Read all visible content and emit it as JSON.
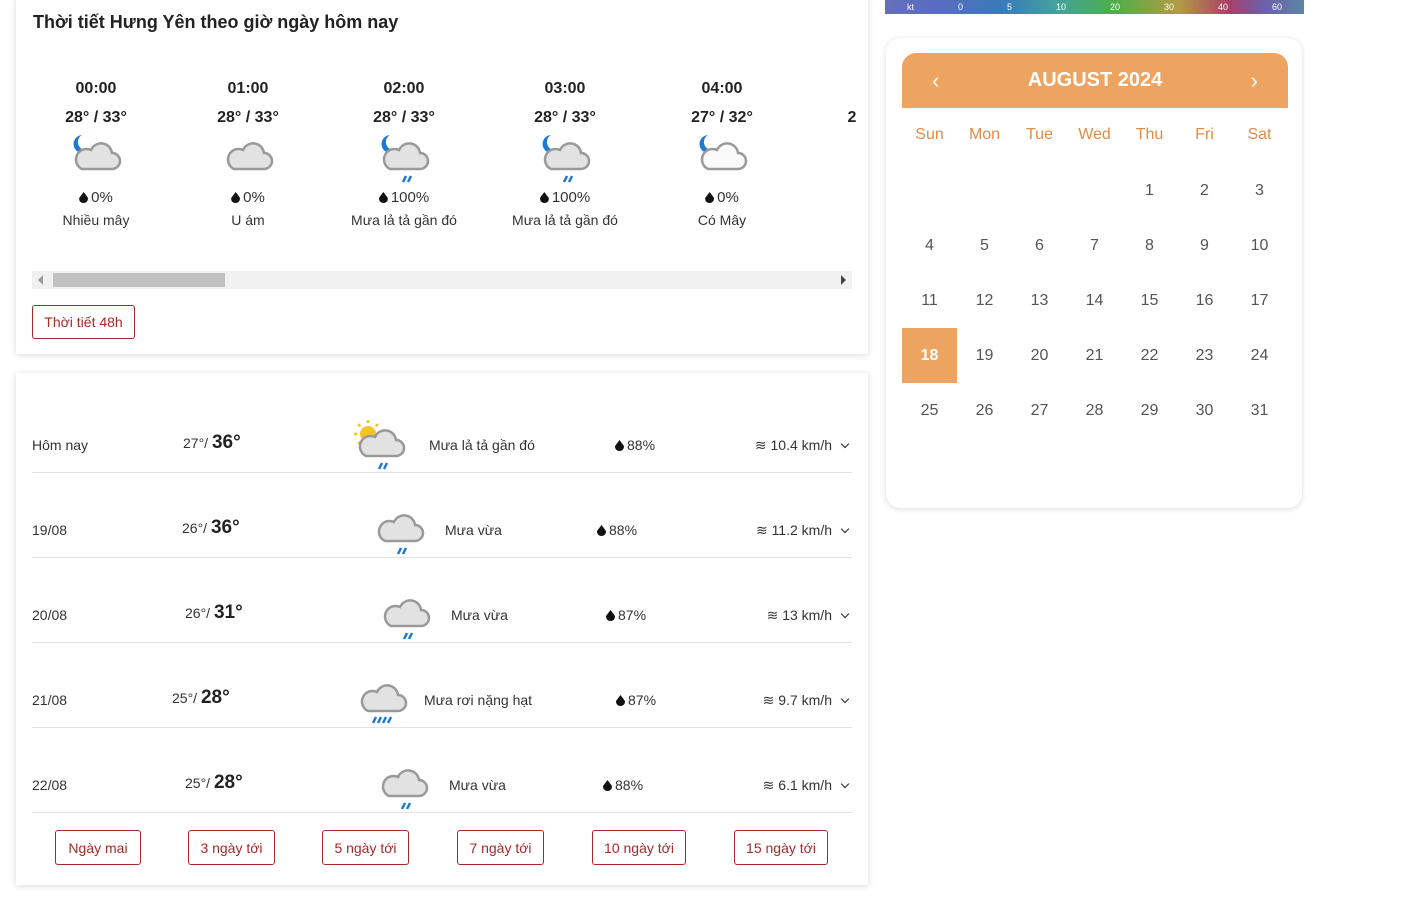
{
  "hourly": {
    "title": "Thời tiết Hưng Yên theo giờ ngày hôm nay",
    "items": [
      {
        "time": "00:00",
        "temp": "28° / 33°",
        "icon": "moon-cloud",
        "precip": "0%",
        "desc": "Nhiều mây"
      },
      {
        "time": "01:00",
        "temp": "28° / 33°",
        "icon": "cloud",
        "precip": "0%",
        "desc": "U ám"
      },
      {
        "time": "02:00",
        "temp": "28° / 33°",
        "icon": "moon-cloud-rain",
        "precip": "100%",
        "desc": "Mưa lả tả gần đó"
      },
      {
        "time": "03:00",
        "temp": "28° / 33°",
        "icon": "moon-cloud-rain",
        "precip": "100%",
        "desc": "Mưa lả tả gần đó"
      },
      {
        "time": "04:00",
        "temp": "27° / 32°",
        "icon": "moon-cloud-light",
        "precip": "0%",
        "desc": "Có Mây"
      },
      {
        "time": "",
        "temp": "2",
        "icon": "moon",
        "precip": "",
        "desc": ""
      }
    ],
    "button": "Thời tiết 48h"
  },
  "daily": {
    "rows": [
      {
        "date": "Hôm nay",
        "low": "27°",
        "high": "36°",
        "icon": "sun-cloud-rain",
        "desc": "Mưa lả tả gần đó",
        "humidity": "88%",
        "wind": "10.4 km/h"
      },
      {
        "date": "19/08",
        "low": "26°",
        "high": "36°",
        "icon": "cloud-rain",
        "desc": "Mưa vừa",
        "humidity": "88%",
        "wind": "11.2 km/h"
      },
      {
        "date": "20/08",
        "low": "26°",
        "high": "31°",
        "icon": "cloud-rain",
        "desc": "Mưa vừa",
        "humidity": "87%",
        "wind": "13 km/h"
      },
      {
        "date": "21/08",
        "low": "25°",
        "high": "28°",
        "icon": "cloud-heavy-rain",
        "desc": "Mưa rơi nặng hạt",
        "humidity": "87%",
        "wind": "9.7 km/h"
      },
      {
        "date": "22/08",
        "low": "25°",
        "high": "28°",
        "icon": "cloud-rain",
        "desc": "Mưa vừa",
        "humidity": "88%",
        "wind": "6.1 km/h"
      }
    ],
    "buttons": [
      "Ngày mai",
      "3 ngày tới",
      "5 ngày tới",
      "7 ngày tới",
      "10 ngày tới",
      "15 ngày tới"
    ]
  },
  "wind_scale": {
    "labels": [
      "kt",
      "0",
      "5",
      "10",
      "20",
      "30",
      "40",
      "60"
    ]
  },
  "calendar": {
    "month": "AUGUST 2024",
    "weekdays": [
      "Sun",
      "Mon",
      "Tue",
      "Wed",
      "Thu",
      "Fri",
      "Sat"
    ],
    "first_weekday": 4,
    "days": 31,
    "selected": 18,
    "accent": "#eda461"
  }
}
